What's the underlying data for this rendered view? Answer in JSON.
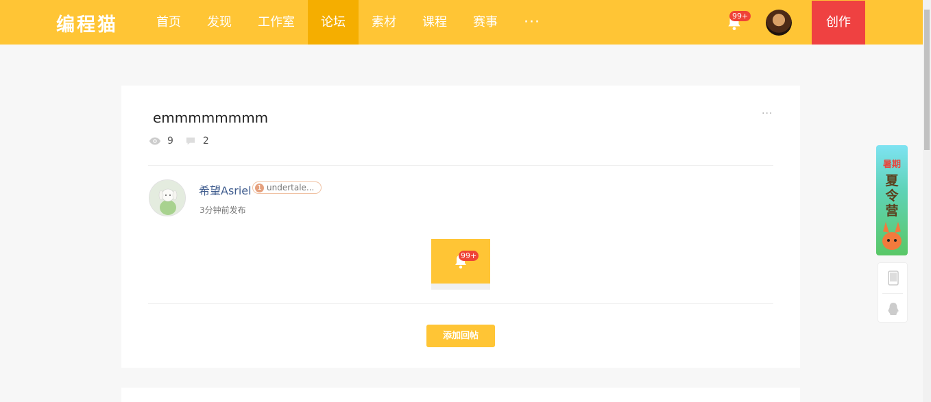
{
  "header": {
    "logo": "编程猫",
    "nav": [
      "首页",
      "发现",
      "工作室",
      "论坛",
      "素材",
      "课程",
      "赛事"
    ],
    "more": "···",
    "notification_count": "99+",
    "create_label": "创作"
  },
  "post": {
    "title": "emmmmmmmm",
    "views": "9",
    "comments": "2",
    "author": {
      "name": "希望Asriel",
      "badge_level": "1",
      "badge_text": "undertale..."
    },
    "time": "3分钟前发布",
    "image_badge": "99+",
    "reply_label": "添加回帖"
  },
  "colors": {
    "brand": "#ffc535",
    "nav_active": "#f5ae00",
    "create": "#ef4141",
    "badge": "#ef4336",
    "author_link": "#3f5c8e"
  },
  "side": {
    "banner_text": "暑期夏令营",
    "tools": [
      "phone-icon",
      "qq-icon"
    ]
  }
}
